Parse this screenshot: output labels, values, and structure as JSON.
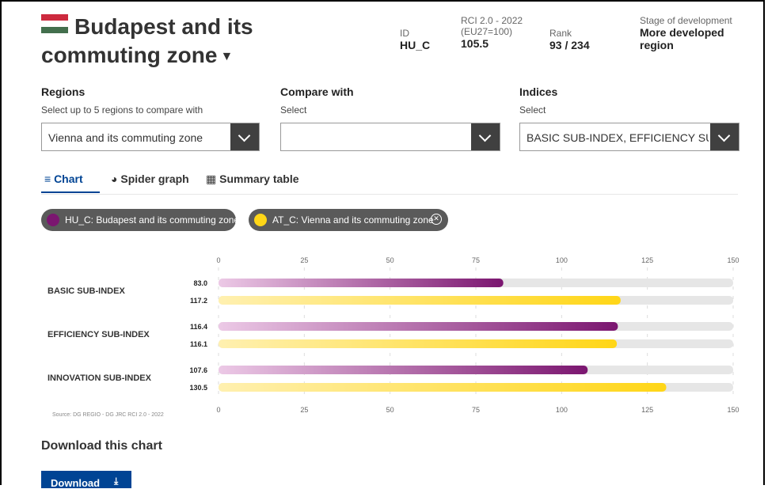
{
  "header": {
    "title": "Budapest and its commuting zone",
    "flag_colors": [
      "#cd2a3e",
      "#ffffff",
      "#436f4d"
    ],
    "id_label": "ID",
    "id_value": "HU_C",
    "rci_label_1": "RCI 2.0 - 2022",
    "rci_label_2": "(EU27=100)",
    "rci_value": "105.5",
    "rank_label": "Rank",
    "rank_value": "93 / 234",
    "stage_label": "Stage of development",
    "stage_value_1": "More developed",
    "stage_value_2": "region"
  },
  "filters": {
    "regions": {
      "label": "Regions",
      "sub": "Select up to 5 regions to compare with",
      "value": "Vienna and its commuting zone"
    },
    "compare": {
      "label": "Compare with",
      "sub": "Select",
      "value": ""
    },
    "indices": {
      "label": "Indices",
      "sub": "Select",
      "value": "BASIC SUB-INDEX, EFFICIENCY SUB-INDEX"
    }
  },
  "tabs": [
    {
      "icon": "line-chart-icon",
      "glyph": "≡",
      "label": "Chart"
    },
    {
      "icon": "pie-chart-icon",
      "glyph": "◕",
      "label": "Spider graph"
    },
    {
      "icon": "table-icon",
      "glyph": "▦",
      "label": "Summary table"
    }
  ],
  "legend": [
    {
      "label": "HU_C: Budapest and its commuting zone",
      "color": "#7b1670"
    },
    {
      "label": "AT_C: Vienna and its commuting zone",
      "color": "#ffd617"
    }
  ],
  "chart_data": {
    "type": "bar",
    "orientation": "horizontal",
    "categories": [
      "BASIC SUB-INDEX",
      "EFFICIENCY SUB-INDEX",
      "INNOVATION SUB-INDEX"
    ],
    "series": [
      {
        "name": "HU_C: Budapest and its commuting zone",
        "values": [
          83.0,
          116.4,
          107.6
        ],
        "labels": [
          "83.0",
          "116.4",
          "107.6"
        ],
        "color_start": "#ecc9e6",
        "color_end": "#7b1670"
      },
      {
        "name": "AT_C: Vienna and its commuting zone",
        "values": [
          117.2,
          116.1,
          130.5
        ],
        "labels": [
          "117.2",
          "116.1",
          "130.5"
        ],
        "color_start": "#fff0b0",
        "color_end": "#ffd617"
      }
    ],
    "xlim": [
      0,
      150
    ],
    "ticks": [
      0,
      25,
      50,
      75,
      100,
      125,
      150
    ],
    "track_color": "#e6e6e6",
    "grid": "dashed vertical"
  },
  "source": "Source: DG REGIO - DG JRC RCI 2.0 - 2022",
  "download": {
    "title": "Download this chart",
    "button": "Download",
    "icon": "download-icon",
    "glyph": "⤓"
  }
}
